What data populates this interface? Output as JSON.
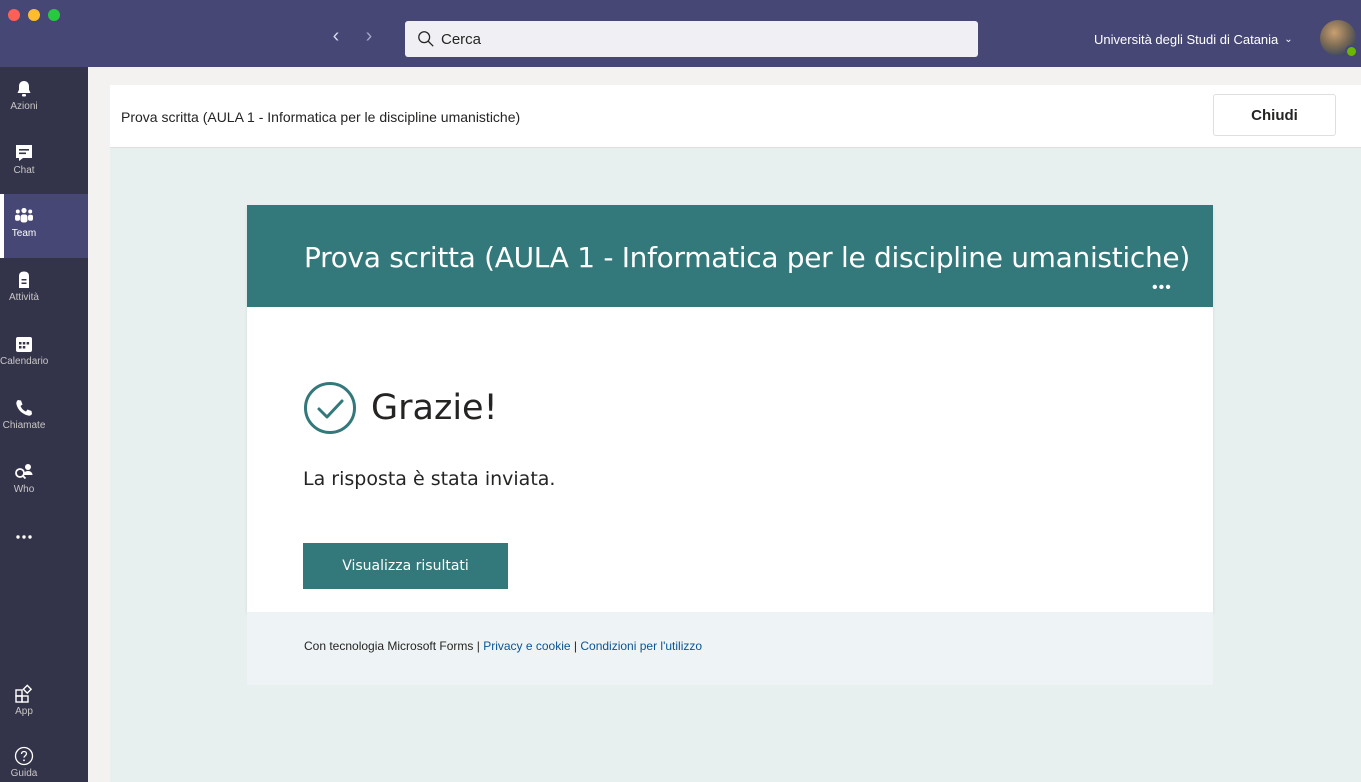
{
  "titlebar": {
    "search_placeholder": "Cerca",
    "organization": "Università degli Studi di Catania"
  },
  "rail": {
    "items": [
      {
        "label": "Azioni",
        "icon": "bell-icon"
      },
      {
        "label": "Chat",
        "icon": "chat-icon"
      },
      {
        "label": "Team",
        "icon": "team-icon",
        "active": true
      },
      {
        "label": "Attività",
        "icon": "assignments-icon"
      },
      {
        "label": "Calendario",
        "icon": "calendar-icon"
      },
      {
        "label": "Chiamate",
        "icon": "phone-icon"
      },
      {
        "label": "Who",
        "icon": "who-icon"
      },
      {
        "label": "App",
        "icon": "apps-icon"
      },
      {
        "label": "Guida",
        "icon": "help-icon"
      }
    ]
  },
  "panel": {
    "title": "Prova scritta (AULA 1 - Informatica per le discipline umanistiche)",
    "close_label": "Chiudi"
  },
  "form": {
    "banner_title": "Prova scritta (AULA 1 - Informatica per le discipline umanistiche)",
    "thanks_title": "Grazie!",
    "thanks_message": "La risposta è stata inviata.",
    "results_button": "Visualizza risultati",
    "footer": {
      "powered_by": "Con tecnologia Microsoft Forms | ",
      "privacy_link": "Privacy e cookie",
      "separator": " | ",
      "terms_link": "Condizioni per l'utilizzo"
    }
  },
  "colors": {
    "titlebar": "#464775",
    "rail": "#33344a",
    "form_accent": "#33787a",
    "panel_background": "#e7f0ef"
  }
}
